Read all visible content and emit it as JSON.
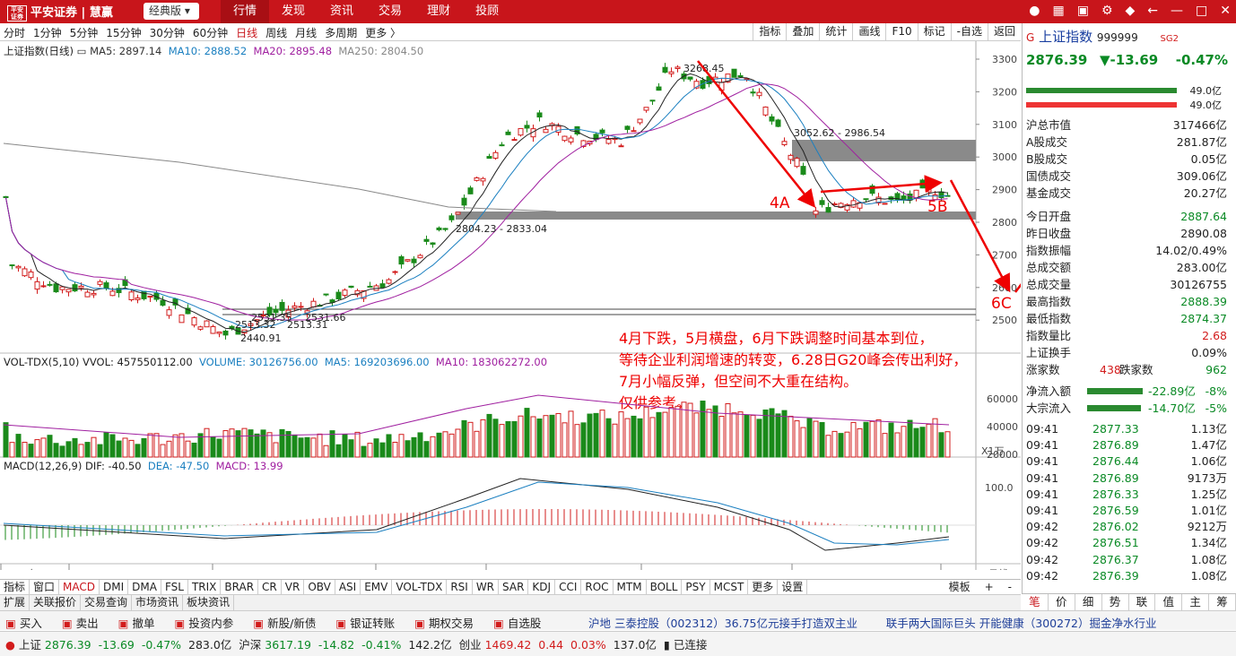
{
  "topbar": {
    "logo": "平安证券",
    "logo_sub": "PING AN SECURITIES",
    "brand": "慧赢",
    "brand_sub": "HUI YING",
    "edition": "经典版",
    "nav": [
      "行情",
      "发现",
      "资讯",
      "交易",
      "理财",
      "投顾"
    ]
  },
  "periodbar": {
    "periods": [
      "分时",
      "1分钟",
      "5分钟",
      "15分钟",
      "30分钟",
      "60分钟",
      "日线",
      "周线",
      "月线",
      "多周期",
      "更多 〉"
    ],
    "tools": [
      "指标",
      "叠加",
      "统计",
      "画线",
      "F10",
      "标记",
      "-自选",
      "返回"
    ]
  },
  "main_legend": {
    "name": "上证指数(日线)",
    "ma5": "MA5: 2897.14",
    "ma10": "MA10: 2888.52",
    "ma20": "MA20: 2895.48",
    "ma250": "MA250: 2804.50"
  },
  "annotations": {
    "high": "3268.45",
    "zone_top": "3052.62 - 2986.54",
    "zone_low": "2804.23 - 2833.04",
    "low1": "2531.35",
    "low2": "2531.66",
    "low3": "2513.32",
    "low4": "2513.31",
    "low5": "2440.91",
    "wave_4a": "4A",
    "wave_5b": "5B",
    "wave_6c": "6C",
    "wave_7": "7(1)",
    "comment": [
      "4月下跌，5月横盘，6月下跌调整时间基本到位，",
      "等待企业利润增速的转变，6.28日G20峰会传出利好，",
      "7月小幅反弹，但空间不大重在结构。",
      "仅供参考。"
    ]
  },
  "price_axis": [
    "3300",
    "3200",
    "3100",
    "3000",
    "2900",
    "2800",
    "2700",
    "2600",
    "2500"
  ],
  "vol_legend": {
    "name": "VOL-TDX(5,10)",
    "vvol": "VVOL: 457550112.00",
    "volume": "VOLUME: 30126756.00",
    "ma5": "MA5: 169203696.00",
    "ma10": "MA10: 183062272.00"
  },
  "vol_axis": [
    "60000",
    "40000",
    "20000"
  ],
  "vol_unit": "X1万",
  "macd_legend": {
    "name": "MACD(12,26,9)",
    "dif": "DIF: -40.50",
    "dea": "DEA: -47.50",
    "macd": "MACD: 13.99"
  },
  "macd_axis": "100.0",
  "x_axis": [
    "2018年",
    "12",
    "1",
    "2",
    "3",
    "4",
    "5",
    "6"
  ],
  "x_right": "日线",
  "indicator_tabs": [
    "指标",
    "窗口",
    "MACD",
    "DMI",
    "DMA",
    "FSL",
    "TRIX",
    "BRAR",
    "CR",
    "VR",
    "OBV",
    "ASI",
    "EMV",
    "VOL-TDX",
    "RSI",
    "WR",
    "SAR",
    "KDJ",
    "CCI",
    "ROC",
    "MTM",
    "BOLL",
    "PSY",
    "MCST",
    "更多",
    "设置"
  ],
  "indicator_right": [
    "模板",
    "+",
    "-"
  ],
  "bottom_tabs": [
    "扩展",
    "关联报价",
    "交易查询",
    "市场资讯",
    "板块资讯"
  ],
  "quote": {
    "name": "上证指数",
    "code": "999999",
    "tag": "SG2",
    "price": "2876.39",
    "change": "▼-13.69",
    "pct": "-0.47%",
    "buy_amt": "49.0亿",
    "sell_amt": "49.0亿",
    "rows": [
      [
        "沪总市值",
        "317466亿"
      ],
      [
        "A股成交",
        "281.87亿"
      ],
      [
        "B股成交",
        "0.05亿"
      ],
      [
        "国债成交",
        "309.06亿"
      ],
      [
        "基金成交",
        "20.27亿"
      ],
      [
        "今日开盘",
        "2887.64"
      ],
      [
        "昨日收盘",
        "2890.08"
      ],
      [
        "指数振幅",
        "14.02/0.49%"
      ],
      [
        "总成交额",
        "283.00亿"
      ],
      [
        "总成交量",
        "30126755"
      ],
      [
        "最高指数",
        "2888.39"
      ],
      [
        "最低指数",
        "2874.37"
      ],
      [
        "指数量比",
        "2.68"
      ],
      [
        "上证换手",
        "0.09%"
      ]
    ],
    "up_label": "涨家数",
    "up": "438",
    "down_label": "跌家数",
    "down": "962",
    "flow1_label": "净流入额",
    "flow1": "-22.89亿",
    "flow1_pct": "-8%",
    "flow2_label": "大宗流入",
    "flow2": "-14.70亿",
    "flow2_pct": "-5%",
    "ticks": [
      [
        "09:41",
        "2877.33",
        "1.13亿"
      ],
      [
        "09:41",
        "2876.89",
        "1.47亿"
      ],
      [
        "09:41",
        "2876.44",
        "1.06亿"
      ],
      [
        "09:41",
        "2876.89",
        "9173万"
      ],
      [
        "09:41",
        "2876.33",
        "1.25亿"
      ],
      [
        "09:41",
        "2876.59",
        "1.01亿"
      ],
      [
        "09:42",
        "2876.02",
        "9212万"
      ],
      [
        "09:42",
        "2876.51",
        "1.34亿"
      ],
      [
        "09:42",
        "2876.37",
        "1.08亿"
      ],
      [
        "09:42",
        "2876.39",
        "1.08亿"
      ]
    ]
  },
  "right_bottom_tabs": [
    "笔",
    "价",
    "细",
    "势",
    "联",
    "值",
    "主",
    "筹"
  ],
  "trade_actions": [
    "买入",
    "卖出",
    "撤单",
    "投资内参",
    "新股/新债",
    "银证转账",
    "期权交易",
    "自选股"
  ],
  "news": [
    "沪地 三泰控股（002312）36.75亿元接手打造双主业",
    "联手两大国际巨头 开能健康（300272）掘金净水行业"
  ],
  "status": {
    "sh_label": "上证",
    "sh": "2876.39",
    "sh_chg": "-13.69",
    "sh_pct": "-0.47%",
    "sh_amt": "283.0亿",
    "sz_label": "沪深",
    "sz": "3617.19",
    "sz_chg": "-14.82",
    "sz_pct": "-0.41%",
    "sz_amt": "142.2亿",
    "cy_label": "创业",
    "cy": "1469.42",
    "cy_chg": "0.44",
    "cy_pct": "0.03%",
    "cy_amt": "137.0亿",
    "conn": "已连接"
  }
}
